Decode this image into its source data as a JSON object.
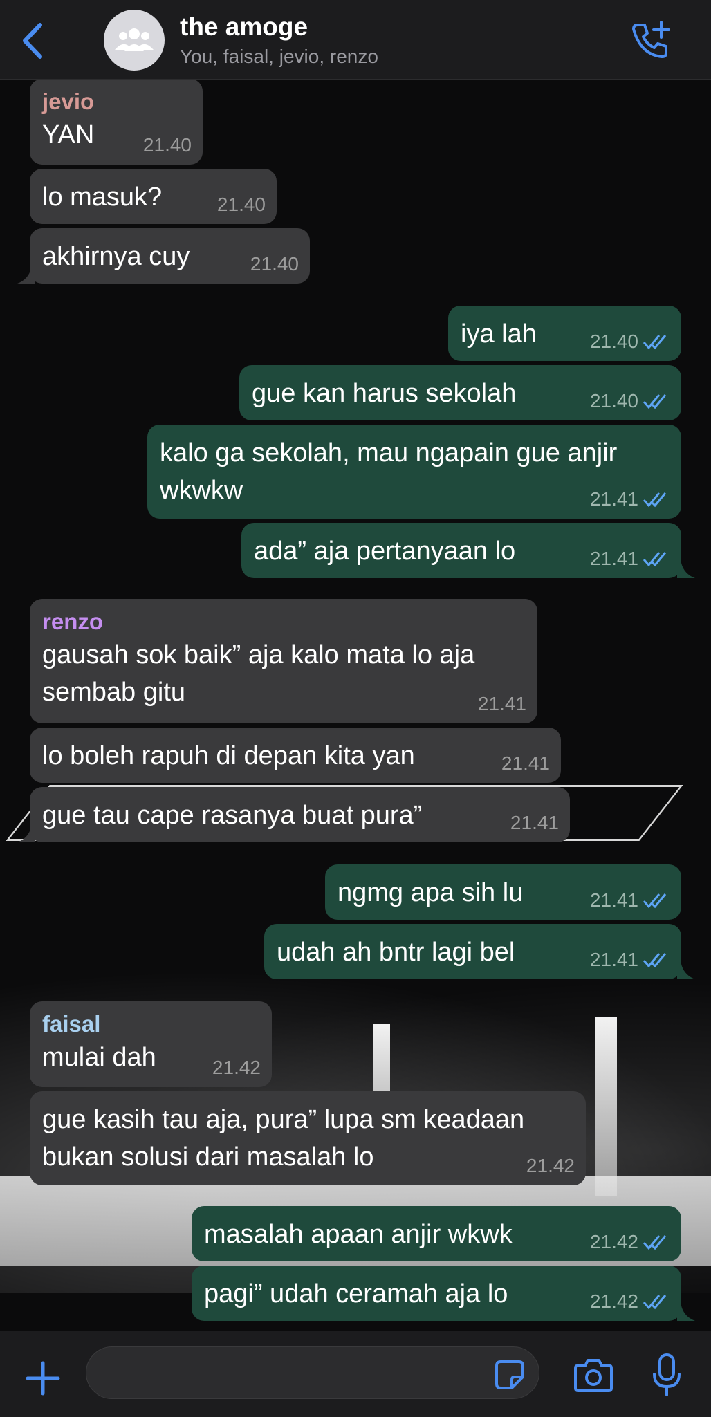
{
  "header": {
    "title": "the amoge",
    "subtitle": "You, faisal, jevio, renzo"
  },
  "colors": {
    "accent": "#4a8cf0",
    "incoming_bubble": "#3a3a3c",
    "outgoing_bubble": "#1f4a3c",
    "jevio": "#d79a96",
    "renzo": "#c58ef0",
    "faisal": "#a9d0ef",
    "read_ticks": "#5ea5f5"
  },
  "icons": {
    "back": "chevron-left-icon",
    "avatar": "group-icon",
    "call": "add-call-icon",
    "plus": "plus-icon",
    "sticker": "sticker-icon",
    "camera": "camera-icon",
    "mic": "microphone-icon"
  },
  "messages": [
    {
      "sender": "jevio",
      "text": "YAN",
      "time": "21.40"
    },
    {
      "text": "lo masuk?",
      "time": "21.40"
    },
    {
      "text": "akhirnya cuy",
      "time": "21.40"
    },
    {
      "text": "iya lah",
      "time": "21.40",
      "status": "read"
    },
    {
      "text": "gue kan harus sekolah",
      "time": "21.40",
      "status": "read"
    },
    {
      "text": "kalo ga sekolah, mau ngapain gue anjir\nwkwkw",
      "time": "21.41",
      "status": "read"
    },
    {
      "text": "ada” aja pertanyaan lo",
      "time": "21.41",
      "status": "read"
    },
    {
      "sender": "renzo",
      "text": "gausah sok baik” aja kalo mata lo aja\nsembab gitu",
      "time": "21.41"
    },
    {
      "text": "lo boleh rapuh di depan kita yan",
      "time": "21.41"
    },
    {
      "text": "gue tau cape rasanya buat pura”",
      "time": "21.41"
    },
    {
      "text": "ngmg apa sih lu",
      "time": "21.41",
      "status": "read"
    },
    {
      "text": "udah ah bntr lagi bel",
      "time": "21.41",
      "status": "read"
    },
    {
      "sender": "faisal",
      "text": "mulai dah",
      "time": "21.42"
    },
    {
      "text": "gue kasih tau aja, pura” lupa sm keadaan\nbukan solusi dari masalah lo",
      "time": "21.42"
    },
    {
      "text": "masalah apaan anjir wkwk",
      "time": "21.42",
      "status": "read"
    },
    {
      "text": "pagi” udah ceramah aja lo",
      "time": "21.42",
      "status": "read"
    }
  ],
  "composer": {
    "value": "",
    "placeholder": ""
  }
}
